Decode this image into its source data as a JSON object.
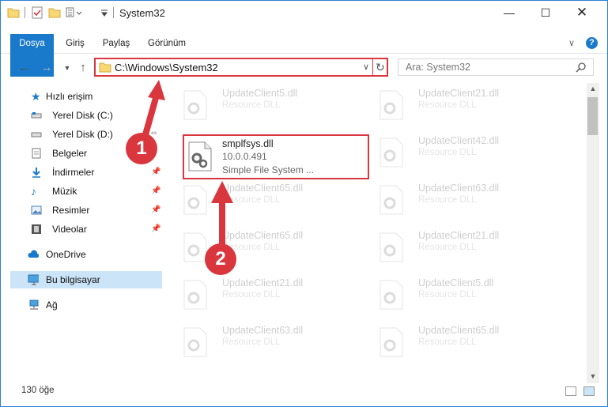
{
  "window": {
    "title": "System32"
  },
  "ribbon": {
    "tabs": [
      "Dosya",
      "Giriş",
      "Paylaş",
      "Görünüm"
    ]
  },
  "address": {
    "path": "C:\\Windows\\System32"
  },
  "search": {
    "placeholder": "Ara: System32"
  },
  "sidebar": {
    "items": [
      {
        "label": "Hızlı erişim",
        "icon": "star-icon"
      },
      {
        "label": "Yerel Disk (C:)",
        "icon": "drive-icon"
      },
      {
        "label": "Yerel Disk (D:)",
        "icon": "drive-icon"
      },
      {
        "label": "Belgeler",
        "icon": "document-icon"
      },
      {
        "label": "İndirmeler",
        "icon": "download-icon"
      },
      {
        "label": "Müzik",
        "icon": "music-icon"
      },
      {
        "label": "Resimler",
        "icon": "pictures-icon"
      },
      {
        "label": "Videolar",
        "icon": "video-icon"
      },
      {
        "label": "OneDrive",
        "icon": "cloud-icon"
      },
      {
        "label": "Bu bilgisayar",
        "icon": "computer-icon"
      },
      {
        "label": "Ağ",
        "icon": "network-icon"
      }
    ]
  },
  "files": {
    "highlighted": {
      "name": "smplfsys.dll",
      "version": "10.0.0.491",
      "description": "Simple File System ..."
    },
    "background": [
      {
        "name": "UpdateClient5.dll",
        "type": "Resource DLL"
      },
      {
        "name": "UpdateClient21.dll",
        "type": "Resource DLL"
      },
      {
        "name": "UpdateClient42.dll",
        "type": "Resource DLL"
      },
      {
        "name": "UpdateClient65.dll",
        "type": "Resource DLL"
      },
      {
        "name": "UpdateClient63.dll",
        "type": "Resource DLL"
      },
      {
        "name": "UpdateClient65.dll",
        "type": "Resource DLL"
      },
      {
        "name": "UpdateClient21.dll",
        "type": "Resource DLL"
      },
      {
        "name": "UpdateClient21.dll",
        "type": "Resource DLL"
      },
      {
        "name": "UpdateClient5.dll",
        "type": "Resource DLL"
      },
      {
        "name": "UpdateClient63.dll",
        "type": "Resource DLL"
      },
      {
        "name": "UpdateClient65.dll",
        "type": "Resource DLL"
      }
    ]
  },
  "status": {
    "count": "130 öğe"
  },
  "callouts": {
    "first": "1",
    "second": "2"
  },
  "colors": {
    "accent": "#1979ca",
    "highlight": "#d9363e",
    "selection": "#cce4f7"
  }
}
